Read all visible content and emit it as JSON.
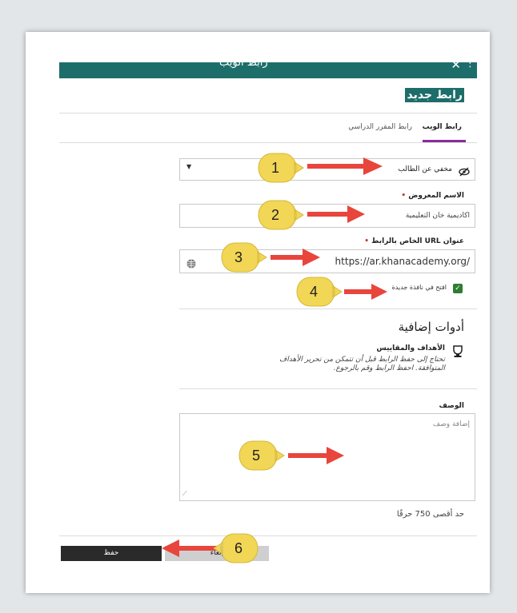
{
  "header": {
    "title": "رابط الويب",
    "close_icon": "close-icon",
    "more_icon": "more-icon"
  },
  "page_title": "رابط جديد",
  "tabs": [
    {
      "label": "رابط الويب",
      "active": true
    },
    {
      "label": "رابط المقرر الدراسي",
      "active": false
    }
  ],
  "visibility": {
    "label": "مخفي عن الطالب",
    "icon": "eye-slash-icon",
    "caret_icon": "chevron-down-icon"
  },
  "name_field": {
    "label": "الاسم المعروض",
    "value": "اكاديمية خان التعليمية"
  },
  "url_field": {
    "label": "عنوان URL الخاص بالرابط",
    "value": "https://ar.khanacademy.org/",
    "icon": "globe-icon"
  },
  "new_window": {
    "label": "افتح في نافذة جديدة",
    "checked": true
  },
  "additional_tools": {
    "title": "أدوات إضافية",
    "goals_title": "الأهداف والمقاييس",
    "goals_text": "تحتاج إلى حفظ الرابط قبل أن تتمكن من تحرير الأهداف المتوافقة. احفظ الرابط وقم بالرجوع."
  },
  "description": {
    "label": "الوصف",
    "placeholder": "إضافة وصف",
    "limit": "حد أقصى 750 حرفًا"
  },
  "footer": {
    "save_label": "حفظ",
    "cancel_label": "إلغاء"
  },
  "annotations": [
    "1",
    "2",
    "3",
    "4",
    "5",
    "6"
  ],
  "colors": {
    "header": "#1d6e6a",
    "tab_underline": "#8a2c9a",
    "checkbox": "#2e7d32",
    "arrow": "#e8453c",
    "callout": "#f2d655"
  }
}
